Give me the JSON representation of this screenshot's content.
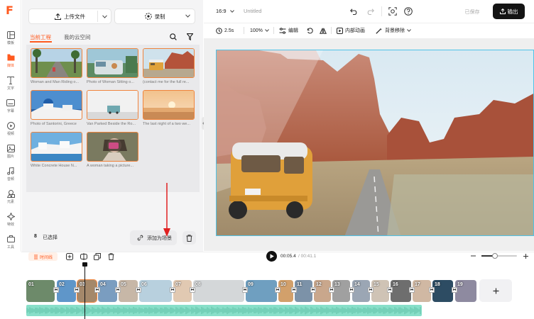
{
  "rail": {
    "items": [
      {
        "label": "模板",
        "icon": "template-icon"
      },
      {
        "label": "媒体",
        "icon": "media-icon"
      },
      {
        "label": "文字",
        "icon": "text-icon"
      },
      {
        "label": "字幕",
        "icon": "subtitle-icon"
      },
      {
        "label": "视频",
        "icon": "video-icon"
      },
      {
        "label": "图片",
        "icon": "image-icon"
      },
      {
        "label": "音频",
        "icon": "audio-icon"
      },
      {
        "label": "元素",
        "icon": "elements-icon"
      },
      {
        "label": "特效",
        "icon": "effects-icon"
      },
      {
        "label": "工具",
        "icon": "tools-icon"
      }
    ],
    "active_index": 1
  },
  "panel": {
    "upload_label": "上传文件",
    "record_label": "录制",
    "tabs": [
      "当前工程",
      "我的云空间"
    ],
    "media": [
      {
        "caption": "Woman and Man Riding o..."
      },
      {
        "caption": "Photo of Woman Sitting o..."
      },
      {
        "caption": "(contact me for the full re..."
      },
      {
        "caption": "Photo of Santorini, Greece"
      },
      {
        "caption": "Van Parked Beside the Ro..."
      },
      {
        "caption": "The last night of a two we..."
      },
      {
        "caption": "White Concrete House N..."
      },
      {
        "caption": "A woman taking a picture..."
      }
    ],
    "selected_count": "8",
    "selected_label": "已选择",
    "add_scene_label": "添加为场景"
  },
  "topbar": {
    "ratio": "16:9",
    "title": "Untitled",
    "saved": "已保存",
    "export": "输出"
  },
  "toolbar": {
    "duration": "2.5s",
    "zoom": "100%",
    "edit": "编辑",
    "inner_anim": "内部动画",
    "bg_remove": "背景移除"
  },
  "timeline": {
    "tag": "时间线",
    "current_time": "00:05.4",
    "total_time": "/ 00:41.1",
    "clips": [
      "01",
      "02",
      "03",
      "04",
      "05",
      "06",
      "07",
      "08",
      "09",
      "10",
      "11",
      "12",
      "13",
      "14",
      "15",
      "16",
      "17",
      "18",
      "19"
    ]
  },
  "colors": {
    "accent": "#ff5a1f",
    "selection": "#4fc3e8",
    "audio": "#88dfc9"
  }
}
